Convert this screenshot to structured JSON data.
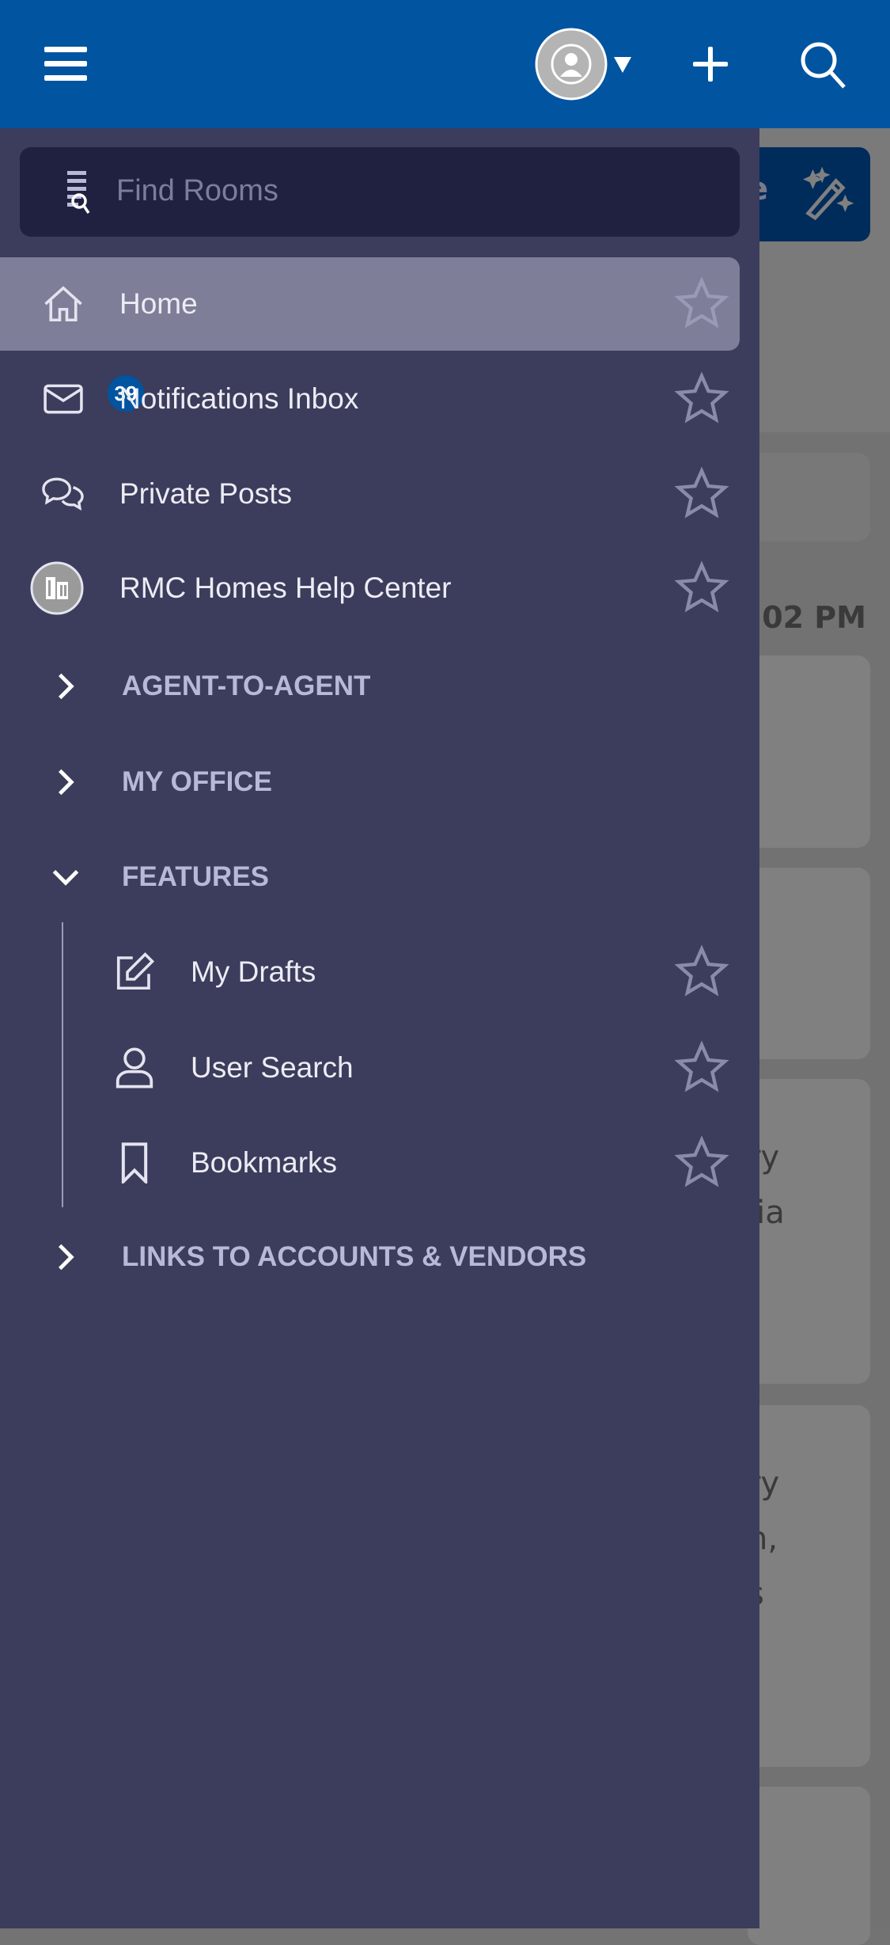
{
  "header": {
    "menu_icon": "hamburger-icon",
    "avatar_icon": "user-avatar-icon",
    "add_icon": "plus-icon",
    "search_icon": "search-icon",
    "background": "#0054a0"
  },
  "search": {
    "placeholder": "Find Rooms"
  },
  "nav": {
    "items": [
      {
        "label": "Home",
        "icon": "home-icon",
        "active": true
      },
      {
        "label": "Notifications Inbox",
        "icon": "envelope-icon",
        "badge": "39"
      },
      {
        "label": "Private Posts",
        "icon": "chat-bubbles-icon"
      },
      {
        "label": "RMC Homes Help Center",
        "icon": "building-icon"
      }
    ],
    "sections": [
      {
        "label": "AGENT-TO-AGENT",
        "expanded": false
      },
      {
        "label": "MY OFFICE",
        "expanded": false
      },
      {
        "label": "FEATURES",
        "expanded": true,
        "items": [
          {
            "label": "My Drafts",
            "icon": "edit-icon"
          },
          {
            "label": "User Search",
            "icon": "user-icon"
          },
          {
            "label": "Bookmarks",
            "icon": "bookmark-icon"
          }
        ]
      },
      {
        "label": "LINKS TO ACCOUNTS & VENDORS",
        "expanded": false
      }
    ]
  },
  "background_page": {
    "button_fragment": "e",
    "time_fragment": ":02 PM",
    "card3": [
      "ry",
      "lia"
    ],
    "card4": [
      "ry",
      "h,",
      "s"
    ]
  }
}
